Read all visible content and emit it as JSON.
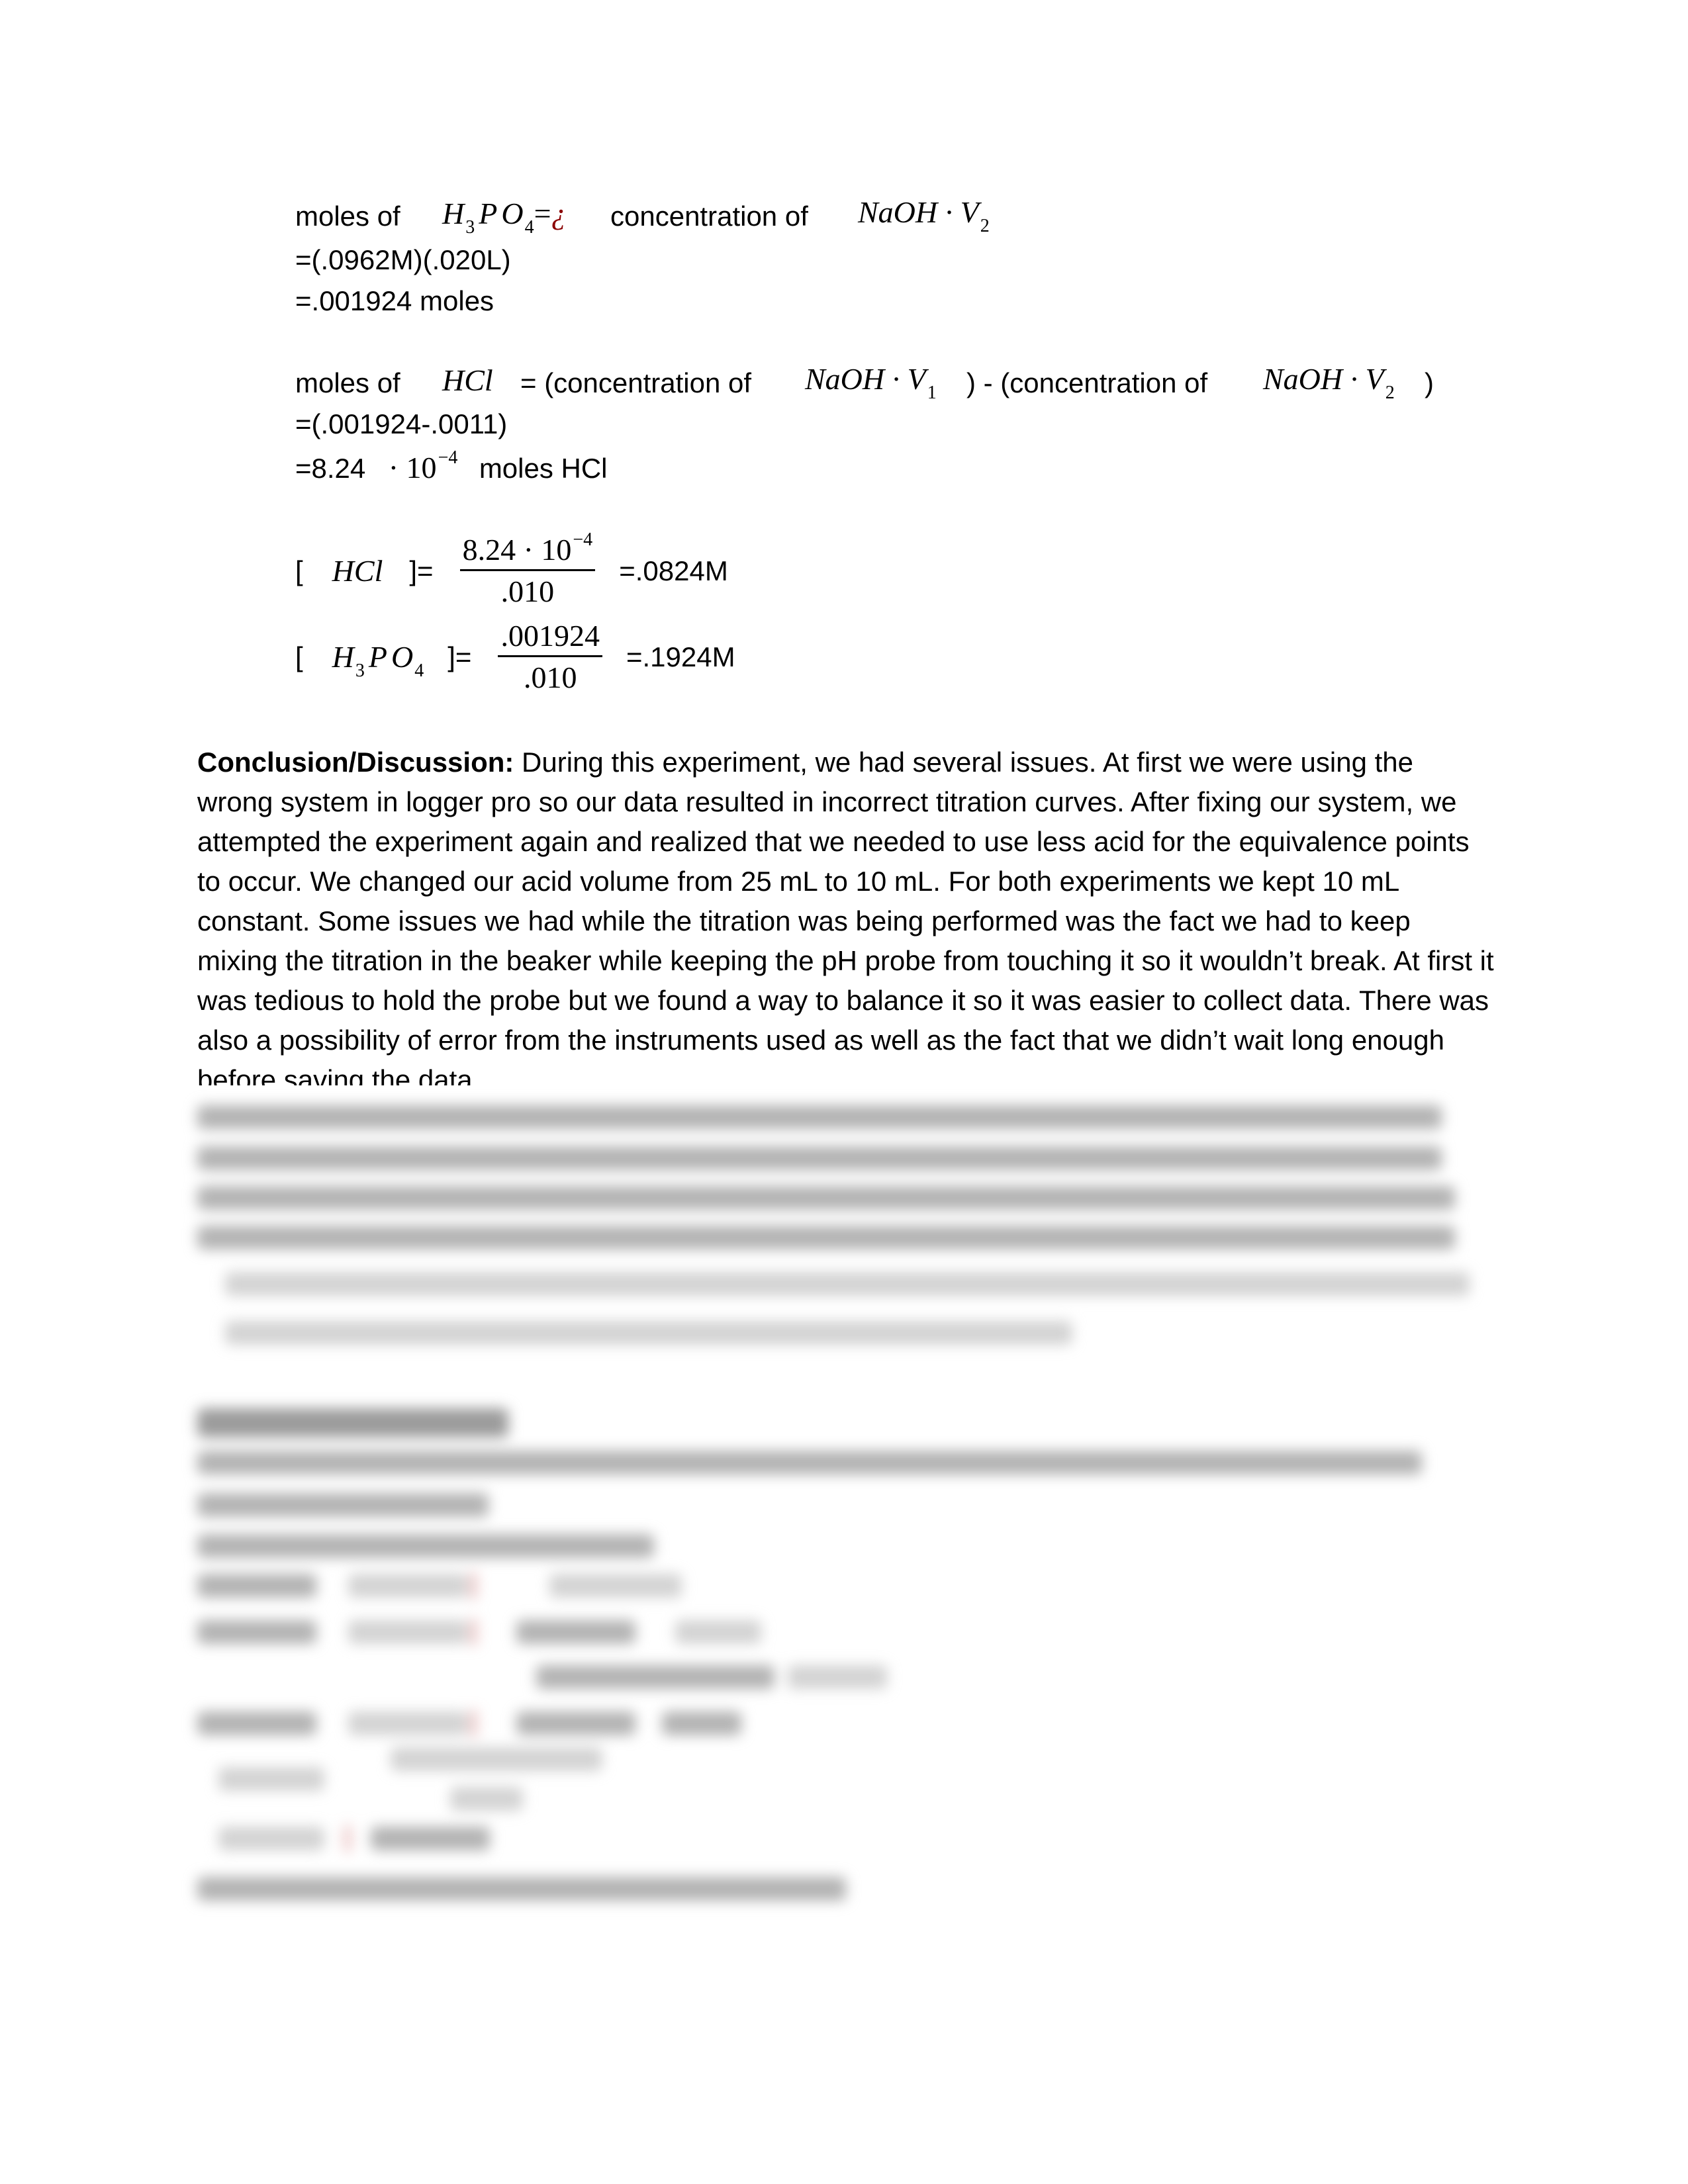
{
  "calc_h3po4_moles": {
    "label": "moles of",
    "species": {
      "base": [
        "H",
        "P",
        "O"
      ],
      "sub1": "3",
      "sub2": "4"
    },
    "equals_glyph": "=",
    "error_glyph": "¿",
    "mid_text": "concentration of",
    "expr": {
      "main": "NaOH · V",
      "sub": "2"
    },
    "step1": "=(.0962M)(.020L)",
    "step2": "=.001924 moles"
  },
  "calc_hcl_moles": {
    "label": "moles of",
    "species": "HCl",
    "eq_text_1": "= (concentration of",
    "expr1": {
      "main": "NaOH · V",
      "sub": "1"
    },
    "eq_text_2": ") - (concentration of",
    "expr2": {
      "main": "NaOH · V",
      "sub": "2"
    },
    "close": ")",
    "step1": "=(.001924-.0011)",
    "step2_value": "=8.24",
    "step2_times": "· 10",
    "step2_exp": "−4",
    "step2_unit": "moles HCl"
  },
  "conc_hcl": {
    "open": "[",
    "species": "HCl",
    "close_eq": "]=",
    "numerator_base": "8.24 · 10",
    "numerator_exp": "−4",
    "denominator": ".010",
    "result": "=.0824M"
  },
  "conc_h3po4": {
    "open": "[",
    "species_base": [
      "H",
      "P",
      "O"
    ],
    "sub1": "3",
    "sub2": "4",
    "close_eq": "]=",
    "numerator": ".001924",
    "denominator": ".010",
    "result": "=.1924M"
  },
  "conclusion": {
    "heading": "Conclusion/Discussion:",
    "body": " During this experiment, we had several issues. At first we were using the wrong system in logger pro so our data resulted in incorrect titration curves. After fixing our system, we attempted the experiment again and realized that we needed to use less acid for the equivalence points to occur. We changed our acid volume from 25 mL to 10 mL. For both experiments we kept 10 mL constant. Some issues we had while the titration was being performed was the fact we had to keep mixing the titration in the beaker while keeping the pH probe from touching it so it wouldn’t break. At first it was tedious to hold the probe but we found a way to balance it so it was easier to collect data. There was also a possibility of error from the instruments used as well as the fact that we didn’t wait long enough before saving the data."
  },
  "colors": {
    "text": "#000000",
    "error_glyph": "#8b0000",
    "background": "#ffffff"
  }
}
